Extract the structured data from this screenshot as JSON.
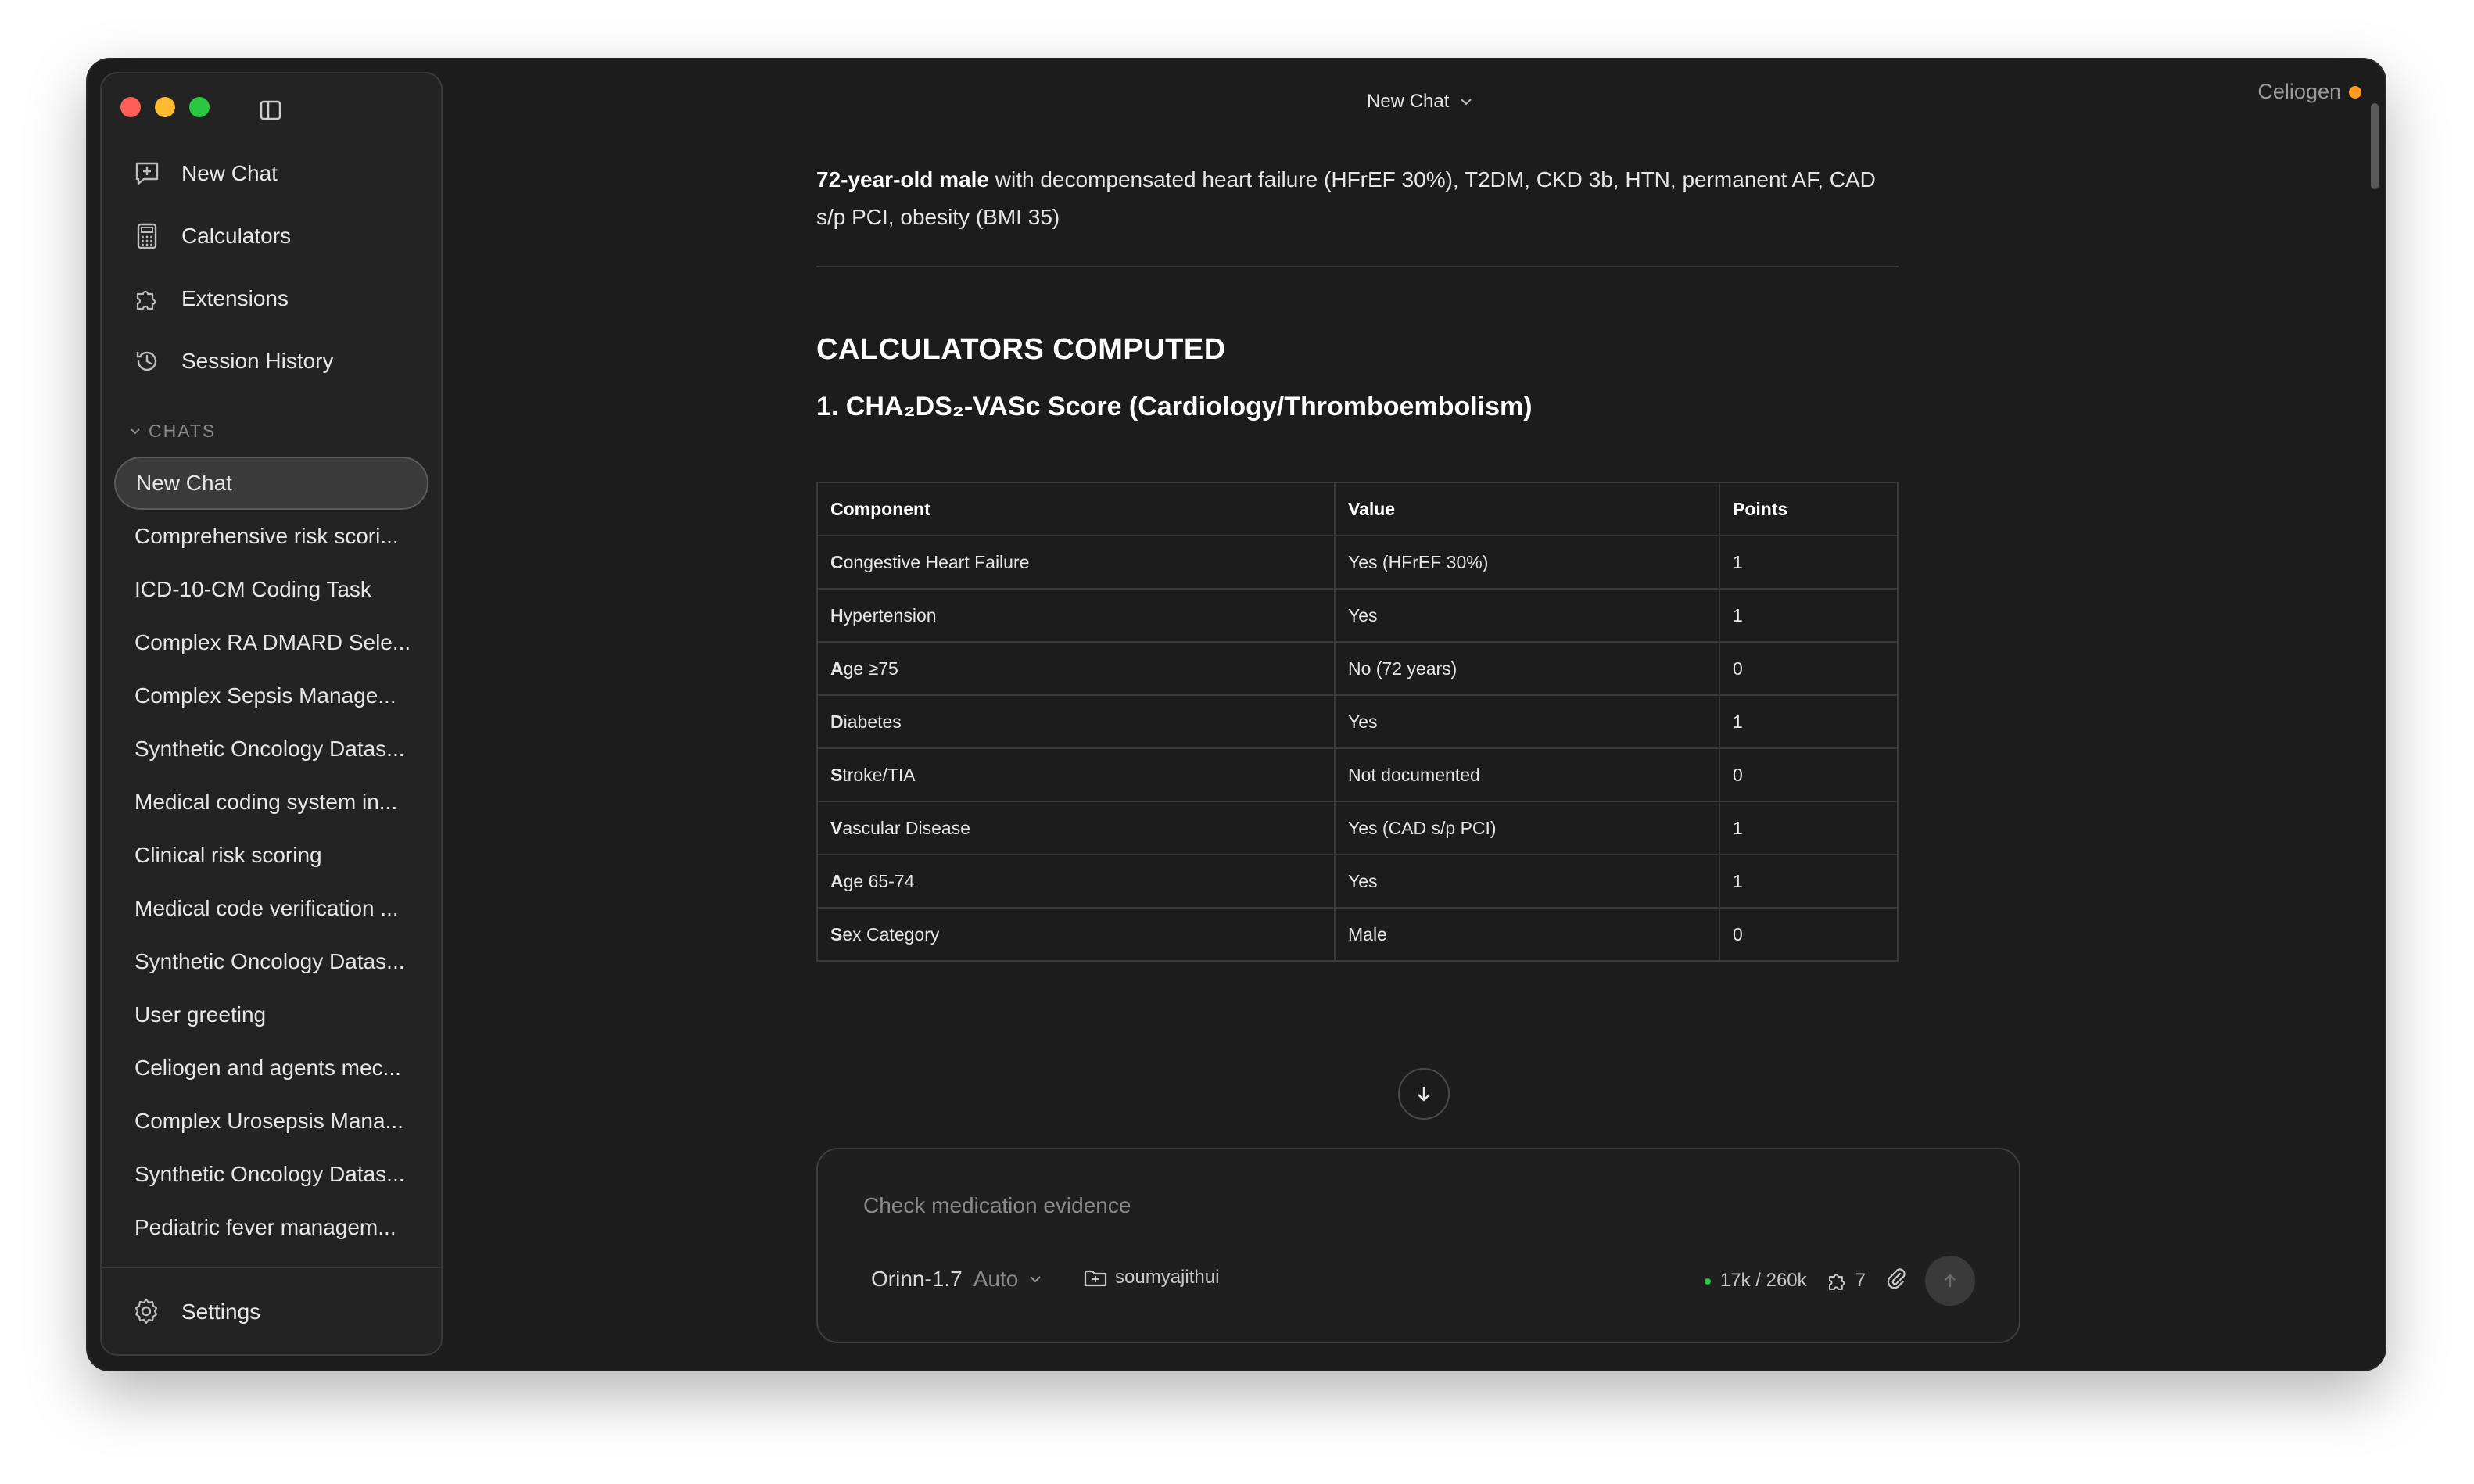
{
  "app": {
    "brand": "Celiogen",
    "title": "New Chat"
  },
  "sidebar": {
    "nav": [
      {
        "label": "New Chat",
        "icon": "new-chat-icon"
      },
      {
        "label": "Calculators",
        "icon": "calculator-icon"
      },
      {
        "label": "Extensions",
        "icon": "puzzle-icon"
      },
      {
        "label": "Session History",
        "icon": "history-icon"
      }
    ],
    "chats_header": "CHATS",
    "chats": [
      "New Chat",
      "Comprehensive risk scori...",
      "ICD-10-CM Coding Task",
      "Complex RA DMARD Sele...",
      "Complex Sepsis Manage...",
      "Synthetic Oncology Datas...",
      "Medical coding system in...",
      "Clinical risk scoring",
      "Medical code verification ...",
      "Synthetic Oncology Datas...",
      "User greeting",
      "Celiogen and agents mec...",
      "Complex Urosepsis Mana...",
      "Synthetic Oncology Datas...",
      "Pediatric fever managem..."
    ],
    "settings": "Settings"
  },
  "content": {
    "intro_bold": "72-year-old male",
    "intro_rest": " with decompensated heart failure (HFrEF 30%), T2DM, CKD 3b, HTN, permanent AF, CAD s/p PCI, obesity (BMI 35)",
    "heading": "CALCULATORS COMPUTED",
    "subheading": "1. CHA₂DS₂-VASc Score (Cardiology/Thromboembolism)",
    "table": {
      "headers": [
        "Component",
        "Value",
        "Points"
      ],
      "rows": [
        {
          "cap": "C",
          "rest": "ongestive Heart Failure",
          "value": "Yes (HFrEF 30%)",
          "points": "1"
        },
        {
          "cap": "H",
          "rest": "ypertension",
          "value": "Yes",
          "points": "1"
        },
        {
          "cap": "A",
          "rest": "ge ≥75",
          "value": "No (72 years)",
          "points": "0"
        },
        {
          "cap": "D",
          "rest": "iabetes",
          "value": "Yes",
          "points": "1"
        },
        {
          "cap": "S",
          "rest": "troke/TIA",
          "value": "Not documented",
          "points": "0"
        },
        {
          "cap": "V",
          "rest": "ascular Disease",
          "value": "Yes (CAD s/p PCI)",
          "points": "1"
        },
        {
          "cap": "A",
          "rest": "ge 65-74",
          "value": "Yes",
          "points": "1"
        },
        {
          "cap": "S",
          "rest": "ex Category",
          "value": "Male",
          "points": "0"
        }
      ]
    }
  },
  "composer": {
    "placeholder": "Check medication evidence",
    "model": "Orinn-1.7",
    "mode": "Auto",
    "folder": "soumyajithui",
    "tokens": "17k / 260k",
    "extensions_count": "7"
  }
}
